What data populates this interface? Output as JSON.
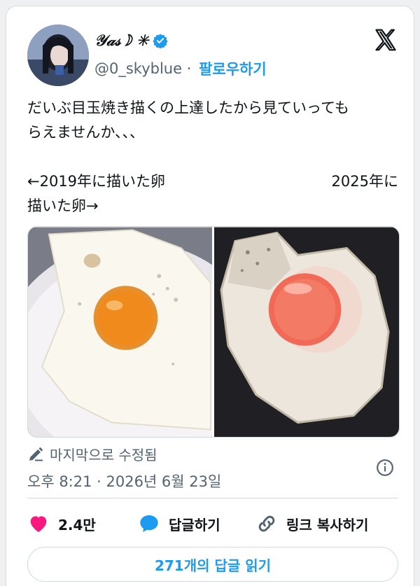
{
  "user": {
    "display_name": "𝒴𝒶𝓈☽ ✳",
    "handle": "@0_skyblue",
    "separator": " · ",
    "follow_label": "팔로우하기"
  },
  "tweet": {
    "line1": "だいぶ目玉焼き描くの上達したから見ていっても",
    "line2": "らえませんか、、、",
    "caption_left": "←2019年に描いた卵",
    "caption_right": "2025年に",
    "line4": "描いた卵→"
  },
  "meta": {
    "edited_label": "마지막으로 수정됨",
    "timestamp": "오후 8:21 · 2026년 6월 23일"
  },
  "actions": {
    "likes": "2.4만",
    "reply_label": "답글하기",
    "copy_link_label": "링크 복사하기"
  },
  "read_replies_label": "271개의 답글 읽기",
  "colors": {
    "accent": "#1d9bf0",
    "like": "#f91880",
    "text": "#0f1419",
    "muted": "#536471"
  },
  "icons": [
    "verified-badge-icon",
    "x-logo-icon",
    "pencil-icon",
    "info-icon",
    "heart-icon",
    "speech-bubble-icon",
    "link-icon"
  ]
}
